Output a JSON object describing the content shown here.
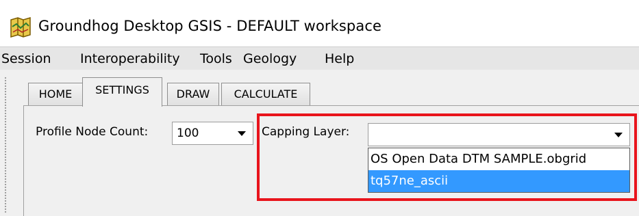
{
  "window": {
    "title": "Groundhog Desktop GSIS - DEFAULT workspace",
    "icon": "groundhog-app-icon"
  },
  "menu": {
    "items": [
      "Session",
      "Interoperability",
      "Tools",
      "Geology",
      "Help"
    ]
  },
  "tabs": {
    "items": [
      "HOME",
      "SETTINGS",
      "DRAW",
      "CALCULATE"
    ],
    "active": "SETTINGS"
  },
  "settings": {
    "profile_node_count": {
      "label": "Profile Node Count:",
      "value": "100"
    },
    "capping_layer": {
      "label": "Capping Layer:",
      "value": "",
      "options": [
        "OS Open Data DTM SAMPLE.obgrid",
        "tq57ne_ascii"
      ],
      "highlighted_option": "tq57ne_ascii"
    }
  },
  "colors": {
    "menubar_bg": "#e6e6e6",
    "content_bg": "#f0f0f0",
    "selection": "#3399ff",
    "annotation_box": "#e8141c"
  }
}
